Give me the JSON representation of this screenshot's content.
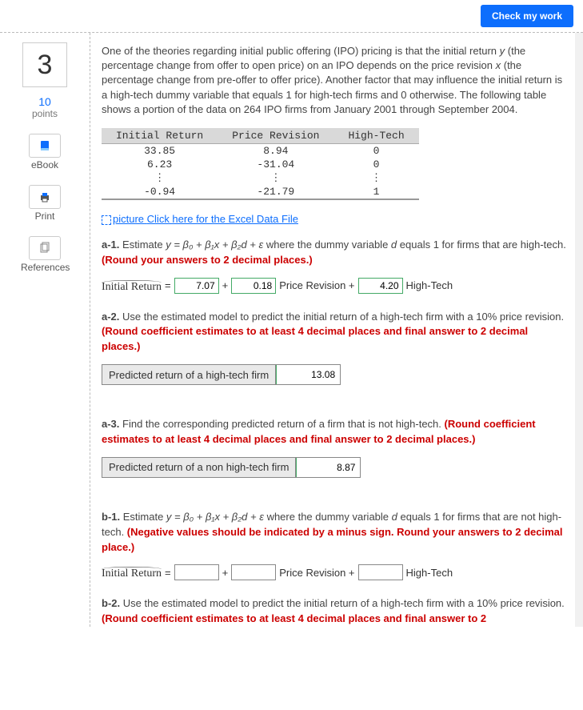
{
  "header": {
    "check_work": "Check my work"
  },
  "sidebar": {
    "question_number": "3",
    "points_value": "10",
    "points_label": "points",
    "ebook": "eBook",
    "print": "Print",
    "references": "References"
  },
  "intro": {
    "text_pre_y": "One of the theories regarding initial public offering (IPO) pricing is that the initial return ",
    "y": "y",
    "text_mid1": " (the percentage change from offer to open price) on an IPO depends on the price revision ",
    "x": "x",
    "text_mid2": " (the percentage change from pre-offer to offer price). Another factor that may influence the initial return is a high-tech dummy variable that equals 1 for high-tech firms and 0 otherwise. The following table shows a portion of the data on 264 IPO firms from January 2001 through September 2004."
  },
  "table": {
    "h1": "Initial Return",
    "h2": "Price Revision",
    "h3": "High-Tech",
    "rows": [
      {
        "c1": "33.85",
        "c2": "8.94",
        "c3": "0"
      },
      {
        "c1": "6.23",
        "c2": "-31.04",
        "c3": "0"
      },
      {
        "c1": "⋮",
        "c2": "⋮",
        "c3": "⋮"
      },
      {
        "c1": "-0.94",
        "c2": "-21.79",
        "c3": "1"
      }
    ]
  },
  "excel_link": {
    "alt": "picture",
    "text": "Click here for the Excel Data File"
  },
  "a1": {
    "tag": "a-1.",
    "pre": " Estimate ",
    "eq": "y = β₀ + β₁x + β₂d + ε",
    "post": " where the dummy variable ",
    "d": "d",
    "post2": " equals 1 for firms that are high-tech. ",
    "instr": "(Round your answers to 2 decimal places.)",
    "label": "Initial  Return",
    "eq_sign": "=",
    "v1": "7.07",
    "plus1": "+",
    "v2": "0.18",
    "term2": "Price Revision +",
    "v3": "4.20",
    "term3": "High-Tech"
  },
  "a2": {
    "tag": "a-2.",
    "body": " Use the estimated model to predict the initial return of a high-tech firm with a 10% price revision. ",
    "instr": "(Round coefficient estimates to at least 4 decimal places and final answer to 2 decimal places.)",
    "row_label": "Predicted return of a high-tech firm",
    "value": "13.08"
  },
  "a3": {
    "tag": "a-3.",
    "body": "  Find the corresponding predicted return of a firm that is not high-tech. ",
    "instr": "(Round coefficient estimates to at least 4 decimal places and final answer to 2 decimal places.)",
    "row_label": "Predicted return of a non high-tech firm",
    "value": "8.87"
  },
  "b1": {
    "tag": "b-1.",
    "pre": " Estimate ",
    "eq": "y = β₀ + β₁x + β₂d + ε",
    "post": " where the dummy variable ",
    "d": "d",
    "post2": " equals 1 for firms that are not high-tech. ",
    "instr": "(Negative values should be indicated by a minus sign. Round your answers to 2 decimal place.)",
    "label": "Initial  Return",
    "eq_sign": "=",
    "plus1": "+",
    "term2": "Price Revision +",
    "term3": "High-Tech"
  },
  "b2": {
    "tag": "b-2.",
    "body": " Use the estimated model to predict the initial return of a high-tech firm with a 10% price revision. ",
    "instr": "(Round coefficient estimates to at least 4 decimal places and final answer to 2"
  }
}
